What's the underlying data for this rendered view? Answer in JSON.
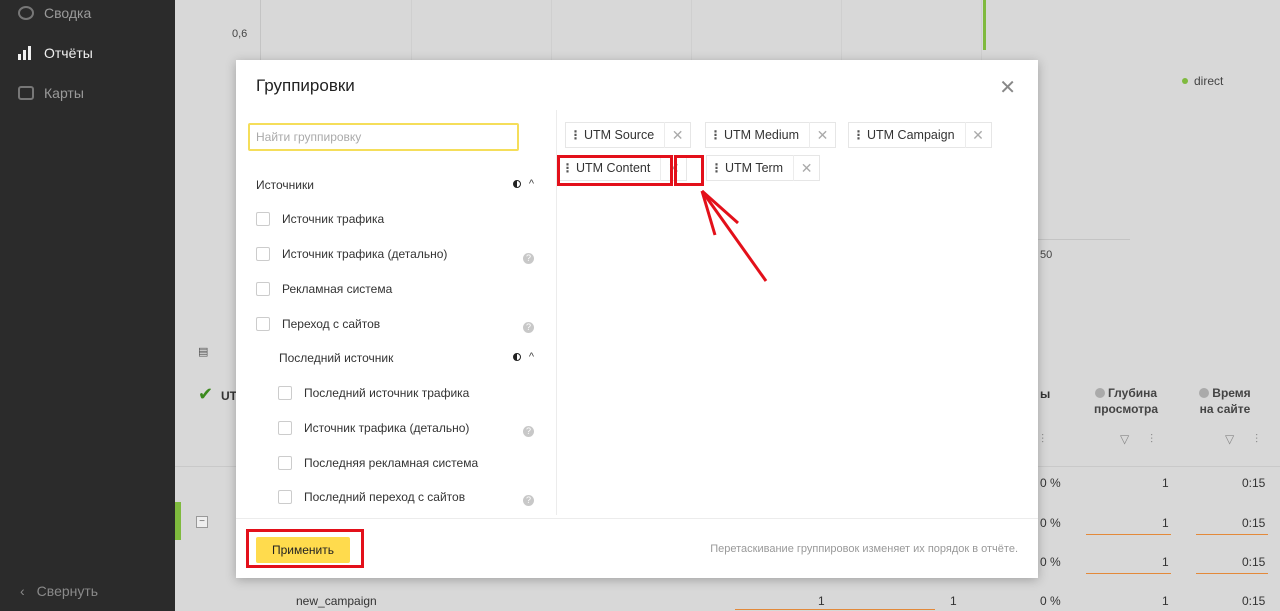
{
  "sidebar": {
    "items": [
      {
        "label": "Сводка",
        "icon": "summary-icon"
      },
      {
        "label": "Отчёты",
        "icon": "bar-chart-icon",
        "active": true
      },
      {
        "label": "Карты",
        "icon": "map-icon"
      }
    ],
    "collapse_label": "Свернуть"
  },
  "background": {
    "y_tick": "0,6",
    "x_tick": "50",
    "legend_series": "direct",
    "col_depth": [
      "Глубина",
      "просмотра"
    ],
    "col_time": [
      "Время",
      "на сайте"
    ],
    "col_left_partial": "UT",
    "col_pct_partial": "ы",
    "pct_ticks": [
      "0 %",
      "0 %",
      "0 %",
      "0 %"
    ],
    "depth_values": [
      "1",
      "1",
      "1",
      "1"
    ],
    "time_values": [
      "0:15",
      "0:15",
      "0:15",
      "0:15"
    ],
    "last_row_label": "new_campaign",
    "last_row_v1": "1",
    "last_row_v2": "1"
  },
  "modal": {
    "title": "Группировки",
    "search_placeholder": "Найти группировку",
    "group_title": "Источники",
    "items": [
      {
        "label": "Источник трафика",
        "help": false,
        "indent": 0
      },
      {
        "label": "Источник трафика (детально)",
        "help": true,
        "indent": 0
      },
      {
        "label": "Рекламная система",
        "help": false,
        "indent": 0
      },
      {
        "label": "Переход с сайтов",
        "help": true,
        "indent": 0
      }
    ],
    "subgroup_title": "Последний источник",
    "sub_items": [
      {
        "label": "Последний источник трафика",
        "help": false
      },
      {
        "label": "Источник трафика (детально)",
        "help": true
      },
      {
        "label": "Последняя рекламная система",
        "help": false
      },
      {
        "label": "Последний переход с сайтов",
        "help": true
      }
    ],
    "selected_chips": [
      "UTM Source",
      "UTM Medium",
      "UTM Campaign",
      "UTM Content",
      "UTM Term"
    ],
    "apply_label": "Применить",
    "hint": "Перетаскивание группировок изменяет их порядок в отчёте."
  },
  "colors": {
    "annotation": "#e3101a",
    "apply_bg": "#ffdb4d",
    "search_border": "#f5de5a",
    "series_green": "#7fba3e"
  }
}
